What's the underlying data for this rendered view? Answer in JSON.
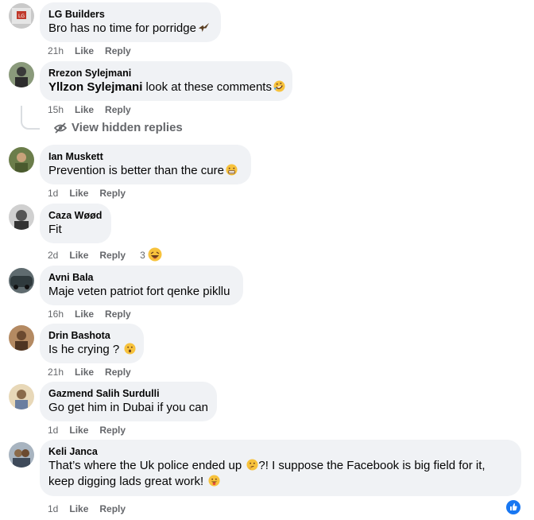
{
  "comments": [
    {
      "author": "LG Builders",
      "text": "Bro has no time for porridge",
      "emoji": "eagle-emoji",
      "time": "21h",
      "like": "Like",
      "reply": "Reply"
    },
    {
      "author": "Rrezon Sylejmani",
      "mention": "Yllzon Sylejmani",
      "text": "look at these comments",
      "emoji": "rolling-laughing-emoji",
      "time": "15h",
      "like": "Like",
      "reply": "Reply"
    },
    {
      "author": "Ian Muskett",
      "text": "Prevention is better than the cure",
      "emoji": "grimacing-emoji",
      "time": "1d",
      "like": "Like",
      "reply": "Reply"
    },
    {
      "author": "Caza Wøød",
      "text": "Fit",
      "time": "2d",
      "like": "Like",
      "reply": "Reply",
      "reaction_count": "3",
      "reaction": "haha-reaction"
    },
    {
      "author": "Avni Bala",
      "text": "Maje veten patriot fort qenke pikllu",
      "time": "16h",
      "like": "Like",
      "reply": "Reply"
    },
    {
      "author": "Drin Bashota",
      "text": "Is he crying ?",
      "emoji": "hushed-emoji",
      "time": "21h",
      "like": "Like",
      "reply": "Reply"
    },
    {
      "author": "Gazmend Salih Surdulli",
      "text": "Go get him in Dubai if you can",
      "time": "1d",
      "like": "Like",
      "reply": "Reply"
    },
    {
      "author": "Keli Janca",
      "text_part1": "That’s where the Uk police ended up",
      "text_part2": "?! I suppose the Facebook is big field for it, keep digging lads great work!",
      "emoji1": "thinking-emoji",
      "emoji2": "tongue-out-emoji",
      "time": "1d",
      "like": "Like",
      "reply": "Reply"
    }
  ],
  "hidden_replies": "View hidden replies",
  "colors": {
    "bubble": "#f0f2f5",
    "meta": "#65676b",
    "accent": "#1877f2"
  }
}
